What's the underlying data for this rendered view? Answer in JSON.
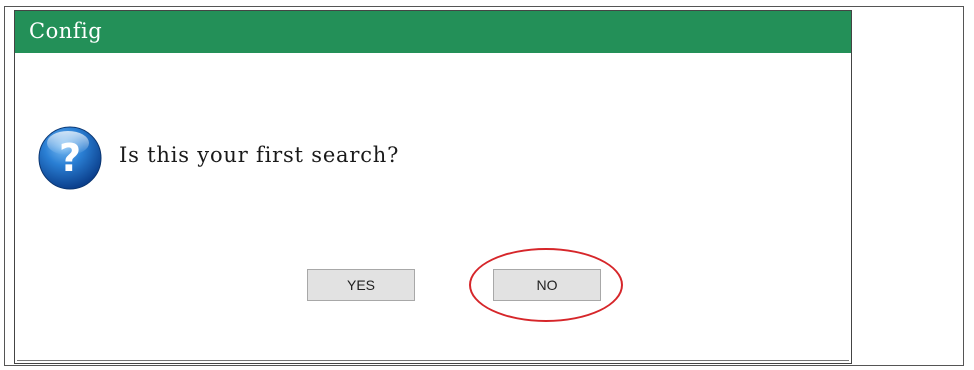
{
  "dialog": {
    "title": "Config",
    "message": "Is this your first search?",
    "icon": "question-icon",
    "buttons": {
      "yes_label": "YES",
      "no_label": "NO"
    },
    "highlighted_button": "NO"
  },
  "colors": {
    "titlebar": "#239058",
    "highlight": "#d6262a",
    "button_bg": "#e2e2e2"
  }
}
